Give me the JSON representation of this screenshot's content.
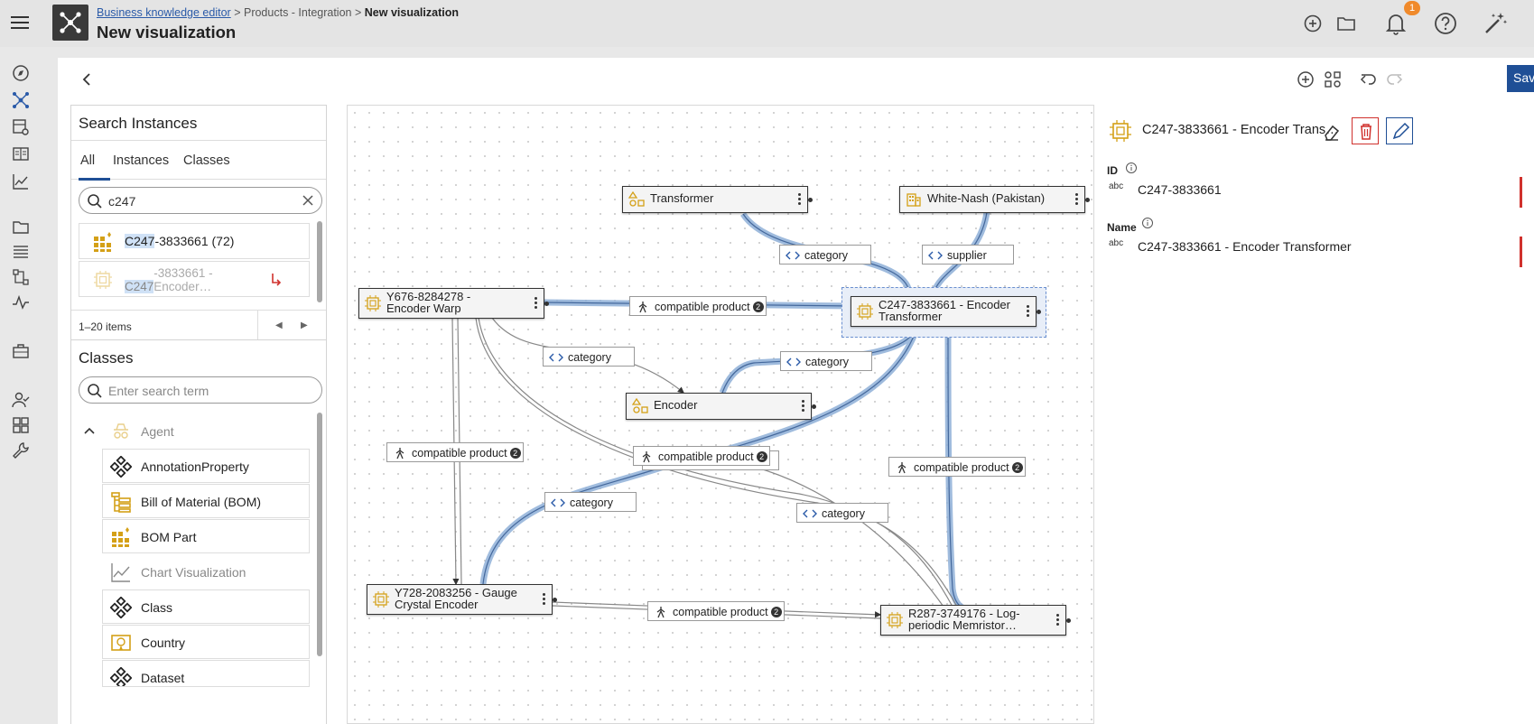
{
  "header": {
    "breadcrumb": {
      "root": "Business knowledge editor",
      "sep1": ">",
      "middle": "Products - Integration",
      "sep2": ">",
      "current": "New visualization"
    },
    "title": "New visualization",
    "notification_count": "1"
  },
  "toolbar": {
    "save_label": "Save"
  },
  "search_panel": {
    "title": "Search Instances",
    "tabs": [
      {
        "label": "All",
        "active": true
      },
      {
        "label": "Instances"
      },
      {
        "label": "Classes"
      }
    ],
    "search_value": "c247",
    "results": [
      {
        "highlight": "C247",
        "rest": "-3833661 (72)"
      },
      {
        "highlight": "C247",
        "rest": "-3833661 - Encoder…"
      }
    ],
    "pager_text": "1–20 items"
  },
  "classes_panel": {
    "title": "Classes",
    "search_placeholder": "Enter search term",
    "items": [
      {
        "label": "Agent",
        "muted": true
      },
      {
        "label": "AnnotationProperty"
      },
      {
        "label": "Bill of Material (BOM)"
      },
      {
        "label": "BOM Part"
      },
      {
        "label": "Chart Visualization",
        "muted": true
      },
      {
        "label": "Class"
      },
      {
        "label": "Country"
      },
      {
        "label": "Dataset"
      }
    ]
  },
  "graph": {
    "nodes": [
      {
        "id": "transformer",
        "label": "Transformer"
      },
      {
        "id": "white_nash",
        "label": "White-Nash (Pakistan)"
      },
      {
        "id": "y676",
        "label": "Y676-8284278 - Encoder Warp"
      },
      {
        "id": "c247",
        "label": "C247-3833661 - Encoder Transformer"
      },
      {
        "id": "encoder",
        "label": "Encoder"
      },
      {
        "id": "y728",
        "label": "Y728-2083256 - Gauge Crystal Encoder"
      },
      {
        "id": "r287",
        "label": "R287-3749176 - Log-periodic Memristor…"
      }
    ],
    "edge_labels": {
      "category": "category",
      "supplier": "supplier",
      "compatible_product": "compatible product",
      "count": "2"
    }
  },
  "properties": {
    "title": "C247-3833661 - Encoder Trans…",
    "fields": [
      {
        "label": "ID",
        "type": "abc",
        "value": "C247-3833661"
      },
      {
        "label": "Name",
        "type": "abc",
        "value": "C247-3833661 - Encoder Transformer"
      }
    ]
  },
  "colors": {
    "accent": "#1f4f96",
    "danger": "#d0312d",
    "edge_highlight": "#8fb0d8",
    "badge": "#f08a2b",
    "class_icon": "#d4a017"
  }
}
